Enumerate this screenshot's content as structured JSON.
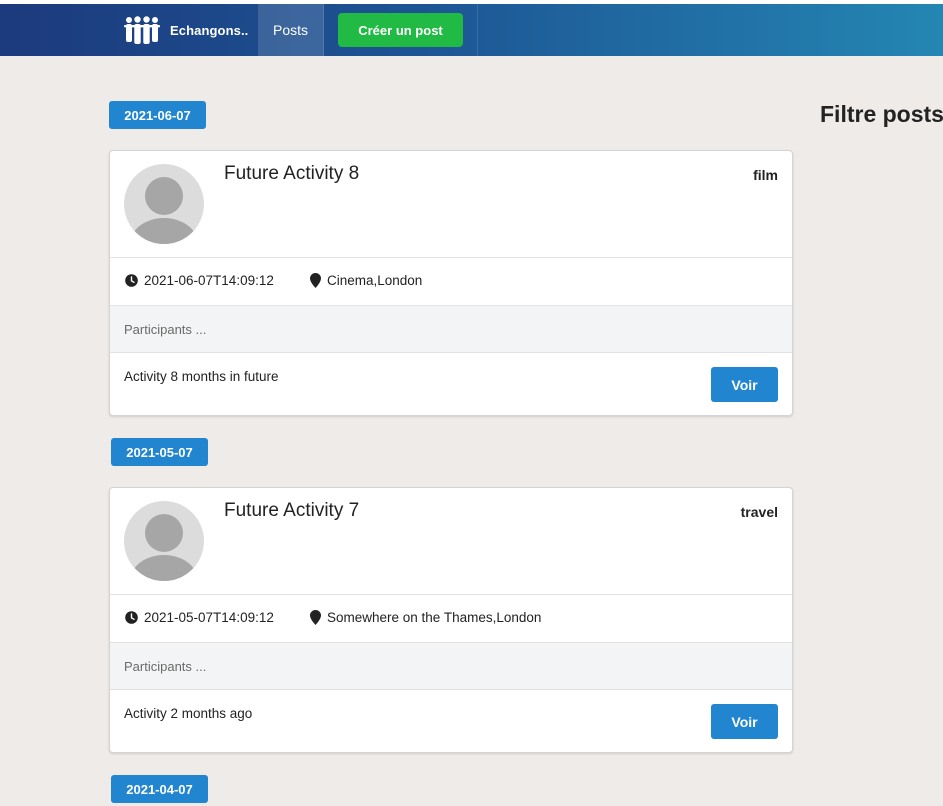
{
  "navbar": {
    "brand_name": "Echangons..",
    "brand_icon": "people-group-icon",
    "posts_label": "Posts",
    "create_label": "Créer un post"
  },
  "sidebar": {
    "filter_title": "Filtre posts"
  },
  "icons": {
    "time": "clock-icon",
    "location": "map-marker-icon",
    "avatar": "user-avatar-placeholder"
  },
  "colors": {
    "primary": "#2185d0",
    "create_button": "#21ba45",
    "nav_start": "#1c3a7d",
    "nav_end": "#2486b3"
  },
  "groups": [
    {
      "date": "2021-06-07",
      "post": {
        "title": "Future Activity 8",
        "category": "film",
        "datetime": "2021-06-07T14:09:12",
        "location": "Cinema,London",
        "participants": "Participants ...",
        "description": "Activity 8 months in future",
        "button_label": "Voir"
      }
    },
    {
      "date": "2021-05-07",
      "post": {
        "title": "Future Activity 7",
        "category": "travel",
        "datetime": "2021-05-07T14:09:12",
        "location": "Somewhere on the Thames,London",
        "participants": "Participants ...",
        "description": "Activity 2 months ago",
        "button_label": "Voir"
      }
    },
    {
      "date": "2021-04-07"
    }
  ]
}
